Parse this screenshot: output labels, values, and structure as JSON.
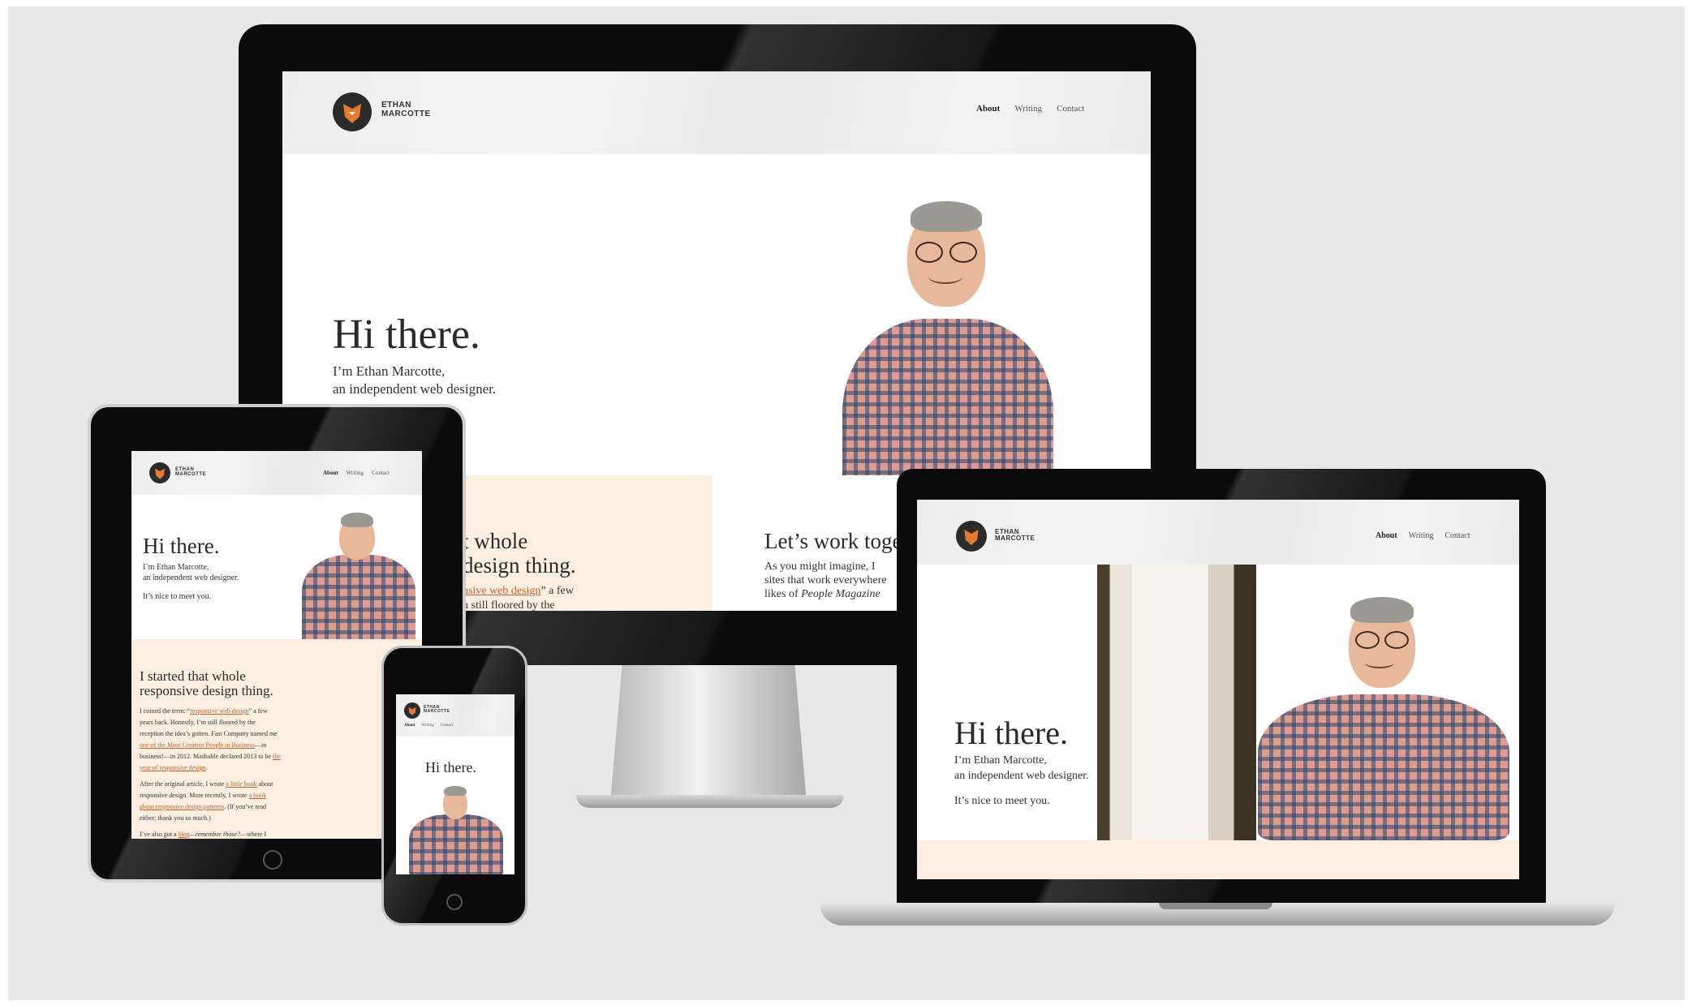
{
  "site": {
    "brand_line1": "ETHAN",
    "brand_line2": "MARCOTTE",
    "nav": [
      "About",
      "Writing",
      "Contact"
    ],
    "hero_title": "Hi there.",
    "intro_line1": "I’m Ethan Marcotte,",
    "intro_line2": "an independent web designer.",
    "nice_to_meet": "It’s nice to meet you.",
    "section1_title_line1": "I started that whole",
    "section1_title_line2": "responsive design thing.",
    "section2_title": "Let’s work together",
    "section2_line1": "As you might imagine, I",
    "section2_line2": "sites that work everywhere",
    "section2_line3_pre": "likes of ",
    "section2_line3_em": "People Magazine"
  },
  "desktop_partial": {
    "s1_line1": "t whole",
    "s1_line2": "design thing.",
    "link_frag": "nsive web design",
    "after_link": "” a few",
    "cut_line": "n still floored by the",
    "cut_dot": "."
  },
  "tablet_body": {
    "p1": [
      {
        "t": "I coined the term: “",
        "l": false
      },
      {
        "t": "responsive web design",
        "l": true
      },
      {
        "t": "” a few",
        "l": false
      }
    ],
    "p1_lines": [
      "years back. Honestly, I’m still floored by the",
      "reception the idea’s gotten. Fast Company named me"
    ],
    "p1_link2": "one of the Most Creative People in Business",
    "p1_after2": "—in",
    "p1_line5": "business!—in 2012. Mashable declared 2013 to be",
    "p1_link3a": "the",
    "p1_link3b": "year of responsive design",
    "p1_end": ".",
    "p2_pre": "After the original article, I wrote ",
    "p2_link1": "a little book",
    "p2_after1": " about",
    "p2_line2_pre": "responsive design. More recently, I wrote ",
    "p2_link2": "a book",
    "p2_link3": "about responsive design patterns",
    "p2_after3": ". (If you’ve read",
    "p2_line4": "either: thank you so much.)",
    "p3_pre": "I’ve also got a ",
    "p3_link": "blog",
    "p3_em": "—remember those?",
    "p3_post": "—where I"
  },
  "colors": {
    "accent": "#c8612a",
    "cream": "#fcefe2",
    "background": "#e8e8e8",
    "bezel": "#0b0b0b",
    "text": "#2a2a2a"
  },
  "icons": {
    "logo": "fox-logo-icon",
    "home_button": "home-button-icon"
  }
}
